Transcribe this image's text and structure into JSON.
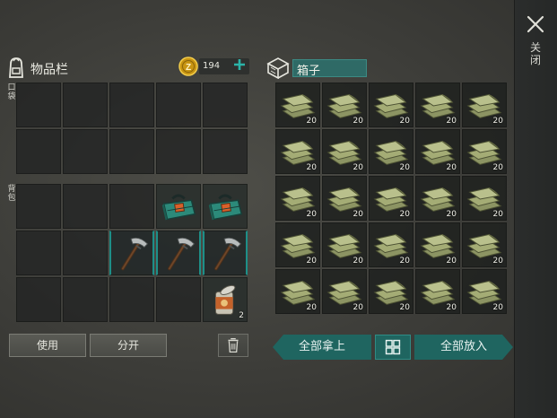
{
  "close": {
    "label": "关闭",
    "icon": "close-icon"
  },
  "inventory": {
    "title": "物品栏",
    "coins": "194",
    "pocket_label": "口袋",
    "backpack_label": "背包",
    "use_button": "使用",
    "split_button": "分开",
    "pocket_slots": [
      "",
      "",
      "",
      "",
      "",
      "",
      "",
      "",
      "",
      ""
    ],
    "backpack_slots": [
      {
        "item": "",
        "count": ""
      },
      {
        "item": "",
        "count": ""
      },
      {
        "item": "",
        "count": ""
      },
      {
        "item": "toolbox",
        "count": ""
      },
      {
        "item": "toolbox",
        "count": ""
      },
      {
        "item": "",
        "count": ""
      },
      {
        "item": "",
        "count": ""
      },
      {
        "item": "hatchet",
        "count": ""
      },
      {
        "item": "hatchet",
        "count": ""
      },
      {
        "item": "hatchet",
        "count": ""
      },
      {
        "item": "",
        "count": ""
      },
      {
        "item": "",
        "count": ""
      },
      {
        "item": "",
        "count": ""
      },
      {
        "item": "",
        "count": ""
      },
      {
        "item": "canned-food",
        "count": "2"
      }
    ]
  },
  "storage": {
    "title": "箱子",
    "take_all_button": "全部拿上",
    "put_all_button": "全部放入",
    "item_icon": "cloth-stack-icon",
    "slots": [
      "20",
      "20",
      "20",
      "20",
      "20",
      "20",
      "20",
      "20",
      "20",
      "20",
      "20",
      "20",
      "20",
      "20",
      "20",
      "20",
      "20",
      "20",
      "20",
      "20",
      "20",
      "20",
      "20",
      "20",
      "20"
    ]
  },
  "colors": {
    "accent": "#1f6560",
    "weapon_border": "#1e8f88",
    "coin": "#d4a418"
  }
}
